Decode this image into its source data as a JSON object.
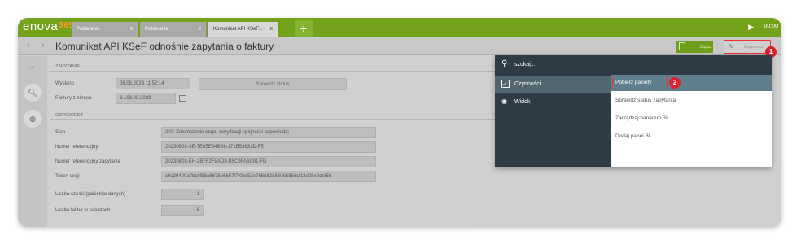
{
  "app": {
    "logo_text": "enova",
    "logo_number": "365",
    "clock": "00:00"
  },
  "tabs": [
    {
      "label": "Pobieranie",
      "close": "x"
    },
    {
      "label": "Pobieranie",
      "close": "x"
    },
    {
      "label": "Komunikat API KSeF...",
      "close": "x"
    }
  ],
  "tab_add": "+",
  "titlebar": {
    "title": "Komunikat API KSeF odnośnie zapytania o faktury",
    "save_label": "Zapisz",
    "actions_label": "Czynności"
  },
  "markers": [
    "1",
    "2"
  ],
  "sections": {
    "request": "ZAPYTANIE",
    "response": "ODPOWIEDŹ"
  },
  "request": {
    "sent_label": "Wysłano",
    "sent_value": "08.08.2023 11:52:14",
    "check_status_button": "Sprawdź status",
    "period_label": "Faktury z okresu",
    "period_value": "8...08.08.2023"
  },
  "response": {
    "rows": [
      {
        "label": "Stan",
        "value": "200: Zakończenie etapu weryfikacji spójności odpowiedzi"
      },
      {
        "label": "Numer referencyjny",
        "value": "20230808-SE-7E85E64BB6-171B53631D-F5"
      },
      {
        "label": "Numer referencyjny zapytania",
        "value": "20230808-EH-2BFF2F8AD8-B5C9FA6D91-FD"
      },
      {
        "label": "Token sesji",
        "value": "c9a29400a7bc9f58a6675b6657f7f0bd53e785d828860b5856cf13d08e0def5b"
      }
    ],
    "parts_label": "Liczba części (pakietów danych)",
    "parts_value": "1",
    "invoices_label": "Liczba faktur w pakietach",
    "invoices_value": "6"
  },
  "dropdown": {
    "search_placeholder": "szukaj...",
    "categories": [
      {
        "label": "Czynności",
        "icon": "checkbox-icon"
      },
      {
        "label": "Widok",
        "icon": "eye-icon"
      }
    ],
    "options": [
      "Pobierz pakiety",
      "Sprawdź status zapytania",
      "Zarządzaj banerem BI",
      "Dodaj panel BI"
    ]
  },
  "colors": {
    "brand_green": "#72a31b",
    "dropdown_dark": "#2e3d45",
    "highlight": "#5f7f8c",
    "marker_red": "#d9232e"
  }
}
